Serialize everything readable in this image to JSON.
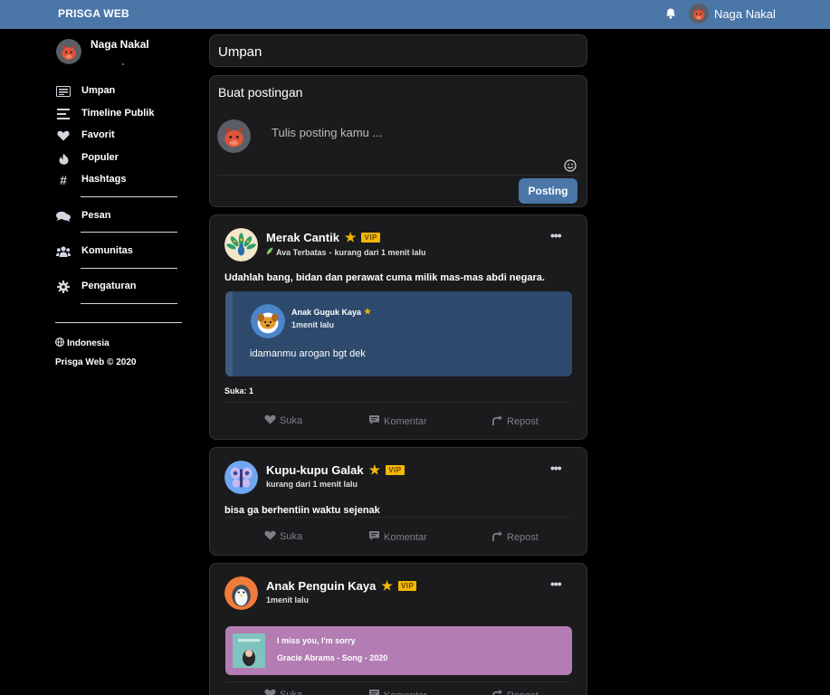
{
  "app": {
    "brand": "PRISGA WEB",
    "accent": "#4a76a8"
  },
  "topbar": {
    "user_name": "Naga Nakal",
    "notif_icon": "bell-icon"
  },
  "sidebar": {
    "user_name": "Naga Nakal",
    "items": [
      {
        "label": "Umpan",
        "icon": "feed-icon"
      },
      {
        "label": "Timeline Publik",
        "icon": "timeline-icon"
      },
      {
        "label": "Favorit",
        "icon": "heart-icon"
      },
      {
        "label": "Populer",
        "icon": "fire-icon"
      },
      {
        "label": "Hashtags",
        "icon": "hashtag-icon"
      },
      {
        "label": "Pesan",
        "icon": "chat-icon"
      },
      {
        "label": "Komunitas",
        "icon": "users-icon"
      },
      {
        "label": "Pengaturan",
        "icon": "gear-icon"
      }
    ],
    "language": "Indonesia",
    "copyright": "Prisga Web © 2020"
  },
  "feed": {
    "title": "Umpan"
  },
  "composer": {
    "title": "Buat postingan",
    "placeholder": "Tulis posting kamu ...",
    "post_label": "Posting"
  },
  "posts": [
    {
      "author": "Merak Cantik",
      "badge": "VIP",
      "audience": "Ava Terbatas",
      "time": "kurang dari 1 menit lalu",
      "text": "Udahlah bang, bidan dan perawat cuma milik mas-mas abdi negara.",
      "quote": {
        "author": "Anak Guguk Kaya",
        "time": "1menit lalu",
        "text": "idamanmu arogan bgt dek"
      },
      "likes": "Suka: 1"
    },
    {
      "author": "Kupu-kupu Galak",
      "badge": "VIP",
      "time": "kurang dari 1 menit lalu",
      "text": "bisa ga berhentiin waktu sejenak"
    },
    {
      "author": "Anak Penguin Kaya",
      "badge": "VIP",
      "time": "1menit lalu",
      "music": {
        "title": "I miss you, I'm sorry",
        "subtitle": "Gracie Abrams - Song - 2020"
      }
    }
  ],
  "actions": {
    "like": "Suka",
    "comment": "Komentar",
    "repost": "Repost"
  }
}
